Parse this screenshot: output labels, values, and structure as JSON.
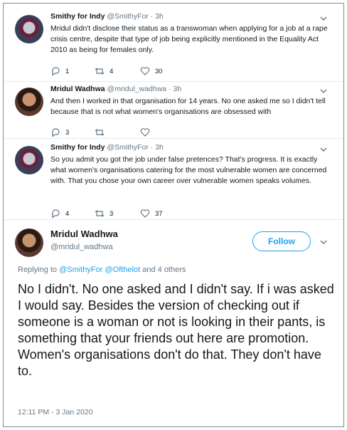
{
  "tweets": [
    {
      "name": "Smithy for Indy",
      "handle": "@SmithyFor",
      "time": "3h",
      "text": "Mridul didn't disclose their status as a transwoman when applying for a job at a rape crisis centre, despite that type of job being explicitly mentioned in the Equality Act 2010 as being for females only.",
      "replies": "1",
      "retweets": "4",
      "likes": "30"
    },
    {
      "name": "Mridul Wadhwa",
      "handle": "@mridul_wadhwa",
      "time": "3h",
      "text": "And then I worked in that organisation for 14 years. No one asked me so I didn't tell because that is not what women's organisations are obsessed with",
      "replies": "3",
      "retweets": "",
      "likes": ""
    },
    {
      "name": "Smithy for Indy",
      "handle": "@SmithyFor",
      "time": "3h",
      "text": "So you admit you got the job under false pretences? That's progress. It is exactly what women's organisations catering for the most vulnerable women are concerned with. That you chose your own career over vulnerable women speaks volumes.",
      "replies": "4",
      "retweets": "3",
      "likes": "37"
    }
  ],
  "separator": "·",
  "main_tweet": {
    "name": "Mridul Wadhwa",
    "handle": "@mridul_wadhwa",
    "follow_label": "Follow",
    "replying_prefix": "Replying to",
    "replying_user1": "@SmithyFor",
    "replying_user2": "@Ofthelot",
    "replying_suffix": "and 4 others",
    "text": "No I didn't. No one asked and I didn't say. If i was asked I would say. Besides the  version of checking out if someone is a woman or not is looking in their pants, is something that your friends out here are promotion. Women's organisations don't do that. They don't have to.",
    "timestamp": "12:11 PM - 3 Jan 2020"
  },
  "colors": {
    "accent": "#1da1f2",
    "muted": "#657786",
    "text": "#14171a"
  },
  "icons": [
    "reply-icon",
    "retweet-icon",
    "like-icon",
    "chevron-down-icon",
    "avatar"
  ]
}
